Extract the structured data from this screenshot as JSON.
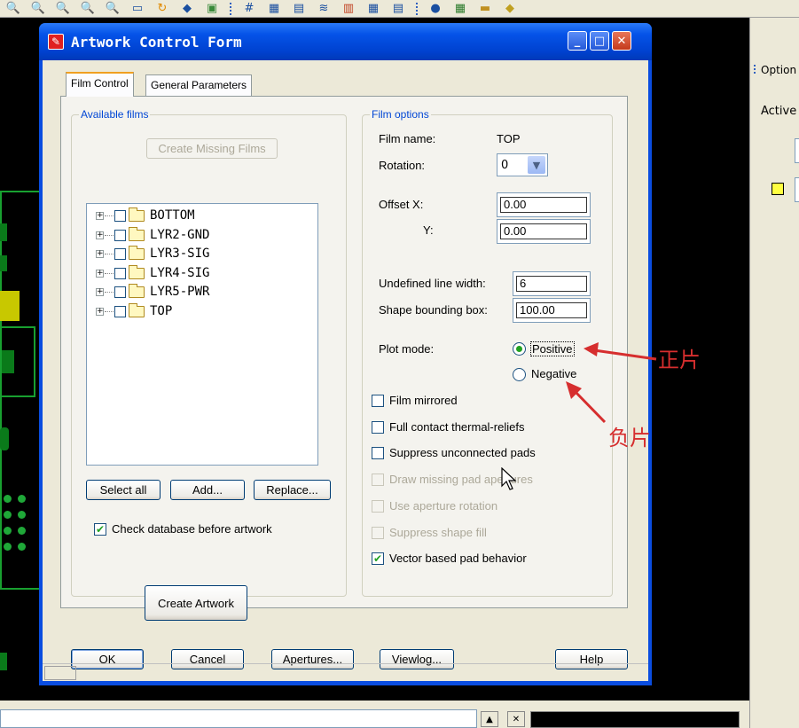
{
  "dialog": {
    "title": "Artwork Control Form",
    "tabs": [
      {
        "label": "Film Control",
        "active": true
      },
      {
        "label": "General Parameters",
        "active": false
      }
    ],
    "available_films": {
      "legend": "Available films",
      "create_missing_label": "Create Missing Films",
      "films": [
        "BOTTOM",
        "LYR2-GND",
        "LYR3-SIG",
        "LYR4-SIG",
        "LYR5-PWR",
        "TOP"
      ],
      "select_all_label": "Select all",
      "add_label": "Add...",
      "replace_label": "Replace...",
      "check_db_label": "Check database before artwork",
      "check_db_checked": true,
      "create_artwork_label": "Create Artwork"
    },
    "film_options": {
      "legend": "Film options",
      "film_name_label": "Film name:",
      "film_name_value": "TOP",
      "rotation_label": "Rotation:",
      "rotation_value": "0",
      "offset_x_label": "Offset  X:",
      "offset_x_value": "0.00",
      "offset_y_label": "Y:",
      "offset_y_value": "0.00",
      "undefined_line_width_label": "Undefined line width:",
      "undefined_line_width_value": "6",
      "shape_bounding_box_label": "Shape bounding box:",
      "shape_bounding_box_value": "100.00",
      "plot_mode_label": "Plot mode:",
      "positive_label": "Positive",
      "negative_label": "Negative",
      "plot_mode_selected": "Positive",
      "checkboxes": [
        {
          "label": "Film mirrored",
          "checked": false,
          "enabled": true
        },
        {
          "label": "Full contact thermal-reliefs",
          "checked": false,
          "enabled": true
        },
        {
          "label": "Suppress unconnected pads",
          "checked": false,
          "enabled": true
        },
        {
          "label": "Draw missing pad apertures",
          "checked": false,
          "enabled": false
        },
        {
          "label": "Use aperture rotation",
          "checked": false,
          "enabled": false
        },
        {
          "label": "Suppress shape fill",
          "checked": false,
          "enabled": false
        },
        {
          "label": "Vector based pad behavior",
          "checked": true,
          "enabled": true
        }
      ]
    },
    "buttons": {
      "ok": "OK",
      "cancel": "Cancel",
      "apertures": "Apertures...",
      "viewlog": "Viewlog...",
      "help": "Help"
    }
  },
  "annotations": {
    "positive": "正片",
    "negative": "负片"
  },
  "right_panel": {
    "options_label": "Option",
    "active_label": "Active"
  },
  "colors": {
    "title_bar": "#0553e8",
    "annotation": "#d62e2e",
    "group_label": "#0046d5",
    "check_mark": "#21a121"
  }
}
